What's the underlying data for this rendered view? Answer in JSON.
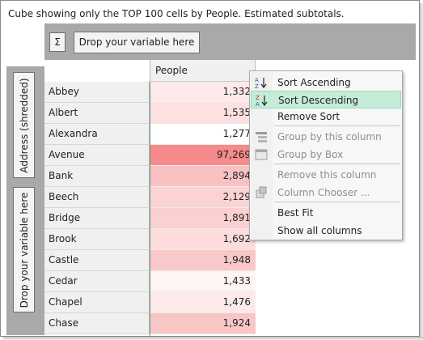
{
  "caption": "Cube showing only the TOP 100 cells by People. Estimated subtotals.",
  "toolbar": {
    "sigma_label": "Σ",
    "drop_label": "Drop your variable here"
  },
  "left_axis": {
    "address_label": "Address (shredded)",
    "drop_label": "Drop your variable here"
  },
  "column_header": "People",
  "rows": [
    {
      "label": "Abbey",
      "value": "1,332",
      "color": "#fde9e9"
    },
    {
      "label": "Albert",
      "value": "1,535",
      "color": "#fde0e0"
    },
    {
      "label": "Alexandra",
      "value": "1,277",
      "color": "#ffffff"
    },
    {
      "label": "Avenue",
      "value": "97,269",
      "color": "#f48a8a"
    },
    {
      "label": "Bank",
      "value": "2,894",
      "color": "#f9c1c1"
    },
    {
      "label": "Beech",
      "value": "2,129",
      "color": "#fbd3d3"
    },
    {
      "label": "Bridge",
      "value": "1,891",
      "color": "#fbd0d0"
    },
    {
      "label": "Brook",
      "value": "1,692",
      "color": "#fcdcdc"
    },
    {
      "label": "Castle",
      "value": "1,948",
      "color": "#f9c8c8"
    },
    {
      "label": "Cedar",
      "value": "1,433",
      "color": "#fdf4f4"
    },
    {
      "label": "Chapel",
      "value": "1,476",
      "color": "#fde9e9"
    },
    {
      "label": "Chase",
      "value": "1,924",
      "color": "#f9c6c6"
    }
  ],
  "context_menu": {
    "items": [
      {
        "label": "Sort Ascending",
        "enabled": true,
        "highlight": false,
        "icon": "sort-az-icon"
      },
      {
        "label": "Sort Descending",
        "enabled": true,
        "highlight": true,
        "icon": "sort-za-icon"
      },
      {
        "label": "Remove Sort",
        "enabled": true,
        "highlight": false,
        "icon": ""
      },
      {
        "label": "Group by this column",
        "enabled": false,
        "highlight": false,
        "icon": "group-column-icon"
      },
      {
        "label": "Group by Box",
        "enabled": false,
        "highlight": false,
        "icon": "group-box-icon"
      },
      {
        "label": "Remove this column",
        "enabled": false,
        "highlight": false,
        "icon": ""
      },
      {
        "label": "Column Chooser ...",
        "enabled": false,
        "highlight": false,
        "icon": "column-chooser-icon"
      },
      {
        "label": "Best Fit",
        "enabled": true,
        "highlight": false,
        "icon": ""
      },
      {
        "label": "Show all columns",
        "enabled": true,
        "highlight": false,
        "icon": ""
      }
    ]
  },
  "colors": {
    "highlight": "#c5ecd7",
    "panel_gray": "#a9a9a9",
    "accent_line": "#6a9e7d"
  }
}
